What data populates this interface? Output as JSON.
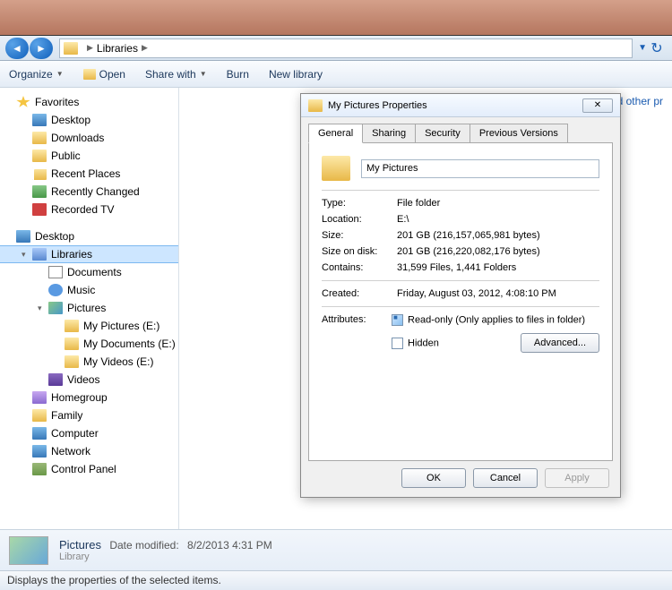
{
  "addressbar": {
    "root": "Libraries"
  },
  "toolbar": {
    "organize": "Organize",
    "open": "Open",
    "share": "Share with",
    "burn": "Burn",
    "newlib": "New library"
  },
  "tree": {
    "favorites": "Favorites",
    "fav_items": [
      "Desktop",
      "Downloads",
      "Public",
      "Recent Places",
      "Recently Changed",
      "Recorded TV"
    ],
    "desktop": "Desktop",
    "libraries": "Libraries",
    "lib_items": [
      "Documents",
      "Music",
      "Pictures",
      "Videos"
    ],
    "pic_children": [
      "My Pictures (E:)",
      "My Documents (E:)",
      "My Videos (E:)"
    ],
    "homegroup": "Homegroup",
    "family": "Family",
    "computer": "Computer",
    "network": "Network",
    "controlpanel": "Control Panel"
  },
  "content_hint": "nd other pr",
  "details": {
    "name": "Pictures",
    "mod_label": "Date modified:",
    "mod_val": "8/2/2013 4:31 PM",
    "type": "Library"
  },
  "status": "Displays the properties of the selected items.",
  "dialog": {
    "title": "My Pictures Properties",
    "tabs": [
      "General",
      "Sharing",
      "Security",
      "Previous Versions"
    ],
    "name": "My Pictures",
    "labels": {
      "type": "Type:",
      "location": "Location:",
      "size": "Size:",
      "size_on_disk": "Size on disk:",
      "contains": "Contains:",
      "created": "Created:",
      "attributes": "Attributes:"
    },
    "values": {
      "type": "File folder",
      "location": "E:\\",
      "size": "201 GB (216,157,065,981 bytes)",
      "size_on_disk": "201 GB (216,220,082,176 bytes)",
      "contains": "31,599 Files, 1,441 Folders",
      "created": "Friday, August 03, 2012, 4:08:10 PM"
    },
    "readonly_label": "Read-only (Only applies to files in folder)",
    "hidden_label": "Hidden",
    "advanced": "Advanced...",
    "ok": "OK",
    "cancel": "Cancel",
    "apply": "Apply"
  }
}
